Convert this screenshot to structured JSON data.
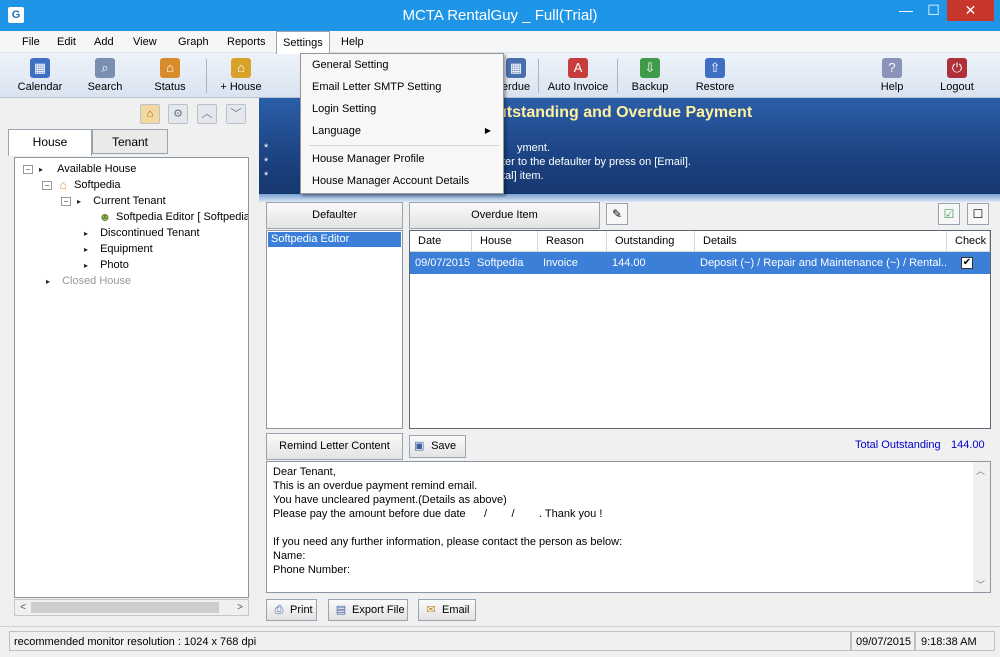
{
  "window": {
    "title": "MCTA RentalGuy _ Full(Trial)",
    "min": "—",
    "max": "☐",
    "close": "✕",
    "app_icon": "G"
  },
  "menubar": [
    "File",
    "Edit",
    "Add",
    "View",
    "Graph",
    "Reports",
    "Settings",
    "Help"
  ],
  "toolbar": {
    "calendar": "Calendar",
    "search": "Search",
    "status": "Status",
    "add_house": "+ House",
    "overdue": "erdue",
    "auto_invoice": "Auto Invoice",
    "backup": "Backup",
    "restore": "Restore",
    "help": "Help",
    "logout": "Logout"
  },
  "settings_menu": {
    "general": "General Setting",
    "smtp": "Email Letter SMTP Setting",
    "login": "Login Setting",
    "language": "Language",
    "language_arrow": "▶",
    "hm_profile": "House Manager Profile",
    "hm_account": "House Manager Account Details"
  },
  "left": {
    "tabs": [
      "House",
      "Tenant"
    ],
    "tree": {
      "available": "Available House",
      "house": "Softpedia",
      "current_tenant": "Current Tenant",
      "tenant": "Softpedia Editor [ Softpedia",
      "discontinued": "Discontinued Tenant",
      "equipment": "Equipment",
      "photo": "Photo",
      "closed": "Closed House"
    }
  },
  "header": {
    "title": "utstanding and Overdue Payment",
    "line1": "*",
    "line1b": "yment.",
    "line2": "*",
    "line2b": "ter to the defaulter by press on [Email].",
    "line3": "*",
    "line3b": "tal] item."
  },
  "defaulter": {
    "header": "Defaulter",
    "items": [
      "Softpedia Editor"
    ]
  },
  "overdue": {
    "header": "Overdue Item",
    "columns": [
      "Date",
      "House",
      "Reason",
      "Outstanding",
      "Details",
      "Check"
    ],
    "rows": [
      {
        "date": "09/07/2015",
        "house": "Softpedia",
        "reason": "Invoice",
        "outstanding": "144.00",
        "details": "Deposit (~) / Repair and Maintenance (~) / Rental...",
        "check": "✔"
      }
    ]
  },
  "remind": {
    "header": "Remind Letter Content",
    "save": "Save",
    "total_label": "Total Outstanding",
    "total_value": "144.00",
    "lines": [
      "Dear Tenant,",
      "This is an overdue payment remind email.",
      "You have uncleared payment.(Details as above)",
      "Please pay the amount before due date      /        /        . Thank you !",
      "",
      "If you need any further information, please contact the person as below:",
      "Name:",
      "Phone Number:"
    ]
  },
  "buttons": {
    "print": "Print",
    "export": "Export File",
    "email": "Email"
  },
  "statusbar": {
    "hint": "recommended monitor resolution : 1024 x 768 dpi",
    "date": "09/07/2015",
    "time": "9:18:38 AM"
  },
  "colors": {
    "titlebar": "#1e95e6",
    "selection": "#3b7fd9",
    "header_title": "#fff1a0",
    "total": "#0000cc"
  }
}
